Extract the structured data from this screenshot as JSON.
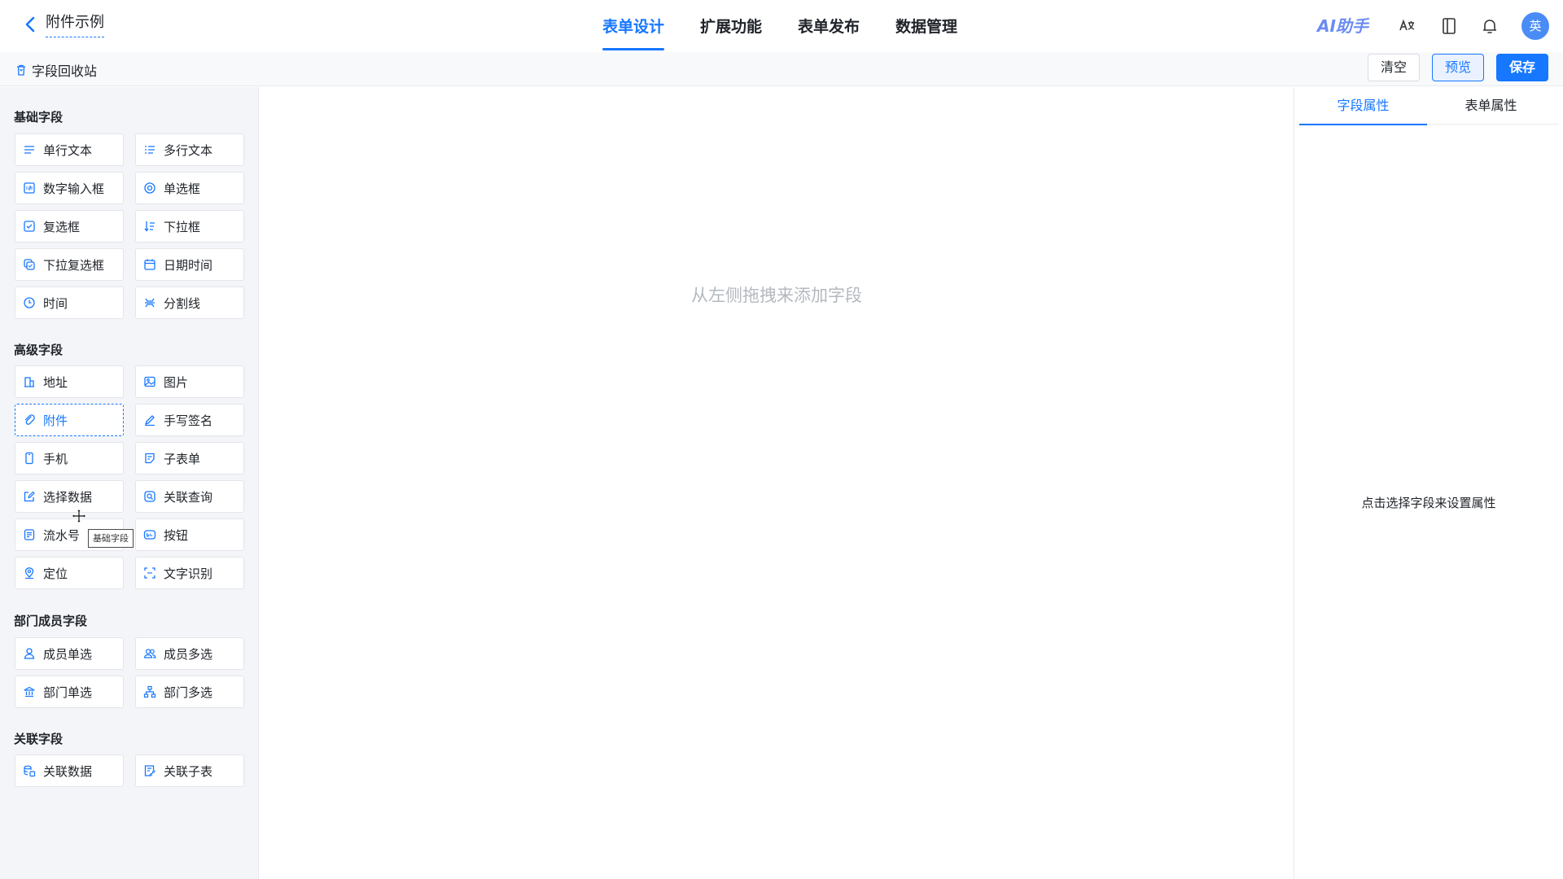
{
  "header": {
    "form_title": "附件示例",
    "tabs": [
      {
        "label": "表单设计",
        "active": true
      },
      {
        "label": "扩展功能",
        "active": false
      },
      {
        "label": "表单发布",
        "active": false
      },
      {
        "label": "数据管理",
        "active": false
      }
    ],
    "ai_label": "AI助手",
    "avatar_text": "英",
    "icons": [
      "translate-icon",
      "book-icon",
      "bell-icon"
    ]
  },
  "toolbar": {
    "recycle_label": "字段回收站",
    "clear_label": "清空",
    "preview_label": "预览",
    "save_label": "保存"
  },
  "palette": {
    "groups": [
      {
        "title": "基础字段",
        "items": [
          {
            "label": "单行文本",
            "icon": "single-line-text-icon"
          },
          {
            "label": "多行文本",
            "icon": "multi-line-text-icon"
          },
          {
            "label": "数字输入框",
            "icon": "number-input-icon"
          },
          {
            "label": "单选框",
            "icon": "radio-icon"
          },
          {
            "label": "复选框",
            "icon": "checkbox-icon"
          },
          {
            "label": "下拉框",
            "icon": "dropdown-icon"
          },
          {
            "label": "下拉复选框",
            "icon": "dropdown-multi-icon"
          },
          {
            "label": "日期时间",
            "icon": "calendar-icon"
          },
          {
            "label": "时间",
            "icon": "clock-icon"
          },
          {
            "label": "分割线",
            "icon": "divider-icon"
          }
        ]
      },
      {
        "title": "高级字段",
        "items": [
          {
            "label": "地址",
            "icon": "building-icon"
          },
          {
            "label": "图片",
            "icon": "image-icon"
          },
          {
            "label": "附件",
            "icon": "paperclip-icon"
          },
          {
            "label": "手写签名",
            "icon": "pen-icon"
          },
          {
            "label": "手机",
            "icon": "phone-icon"
          },
          {
            "label": "子表单",
            "icon": "subform-icon"
          },
          {
            "label": "选择数据",
            "icon": "edit-select-icon"
          },
          {
            "label": "关联查询",
            "icon": "linked-query-icon"
          },
          {
            "label": "流水号",
            "icon": "serial-number-icon"
          },
          {
            "label": "按钮",
            "icon": "button-icon"
          },
          {
            "label": "定位",
            "icon": "location-icon"
          },
          {
            "label": "文字识别",
            "icon": "ocr-scan-icon"
          }
        ]
      },
      {
        "title": "部门成员字段",
        "items": [
          {
            "label": "成员单选",
            "icon": "user-icon"
          },
          {
            "label": "成员多选",
            "icon": "users-icon"
          },
          {
            "label": "部门单选",
            "icon": "department-icon"
          },
          {
            "label": "部门多选",
            "icon": "org-tree-icon"
          }
        ]
      },
      {
        "title": "关联字段",
        "items": [
          {
            "label": "关联数据",
            "icon": "linked-data-icon"
          },
          {
            "label": "关联子表",
            "icon": "linked-subtable-icon"
          }
        ]
      }
    ],
    "tooltip": "基础字段"
  },
  "canvas": {
    "empty_hint": "从左侧拖拽来添加字段"
  },
  "props_panel": {
    "tabs": [
      {
        "label": "字段属性",
        "active": true
      },
      {
        "label": "表单属性",
        "active": false
      }
    ],
    "empty_hint": "点击选择字段来设置属性"
  },
  "colors": {
    "primary": "#1677ff",
    "ai_accent": "#6b8bf2",
    "avatar_bg": "#4a8cf6",
    "palette_bg": "#f4f5f8",
    "hint_text": "#b4b8bf"
  }
}
